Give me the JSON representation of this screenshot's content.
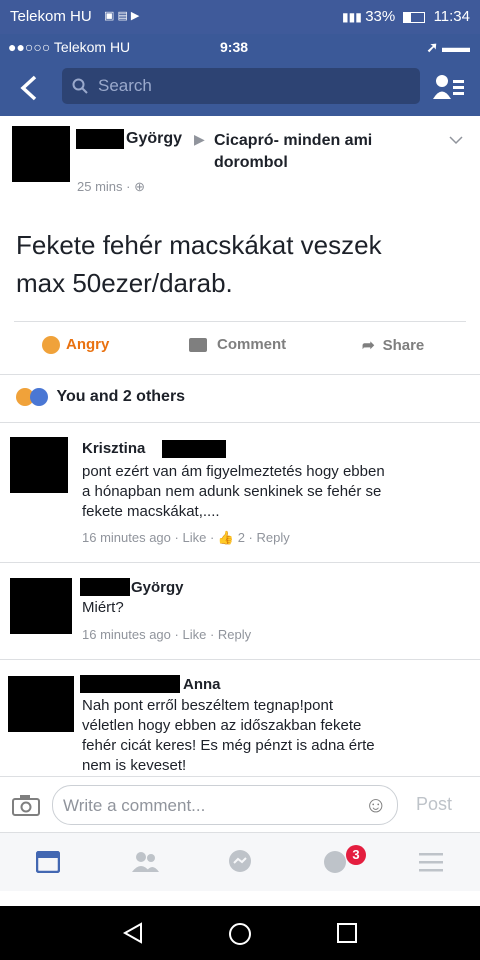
{
  "android_status": {
    "carrier": "Telekom HU",
    "battery": "33%",
    "time": "11:34"
  },
  "ios_status": {
    "carrier": "●●○○○ Telekom HU",
    "time": "9:38"
  },
  "header": {
    "search_placeholder": "Search"
  },
  "post": {
    "author_suffix": "György",
    "group": "Cicapró- minden ami dorombol",
    "time": "25 mins ·",
    "body_line1": "Fekete fehér macskákat veszek",
    "body_line2": "max 50ezer/darab.",
    "actions": {
      "reaction": "Angry",
      "comment": "Comment",
      "share": "Share"
    },
    "reactions_text": "You and 2 others"
  },
  "comments": [
    {
      "name": "Krisztina",
      "line1": "pont ezért van ám figyelmeztetés hogy ebben",
      "line2": "a  hónapban nem adunk senkinek se fehér se",
      "line3": "fekete macskákat,....",
      "time": "16 minutes ago",
      "like": "Like",
      "likes_count": "2",
      "reply": "Reply"
    },
    {
      "name": "György",
      "line1": "Miért?",
      "time": "16 minutes ago",
      "like": "Like",
      "reply": "Reply"
    },
    {
      "name": "Anna",
      "line1": "Nah pont erről beszéltem tegnap!pont",
      "line2": "véletlen hogy ebben az időszakban fekete",
      "line3": "fehér cicát keres! Es még pénzt is adna érte",
      "line4": "nem is keveset!"
    }
  ],
  "composer": {
    "placeholder": "Write a comment...",
    "post_label": "Post"
  },
  "tabs": {
    "notification_badge": "3"
  },
  "colors": {
    "fb_blue": "#3b5998",
    "badge_red": "#e41e3f"
  }
}
